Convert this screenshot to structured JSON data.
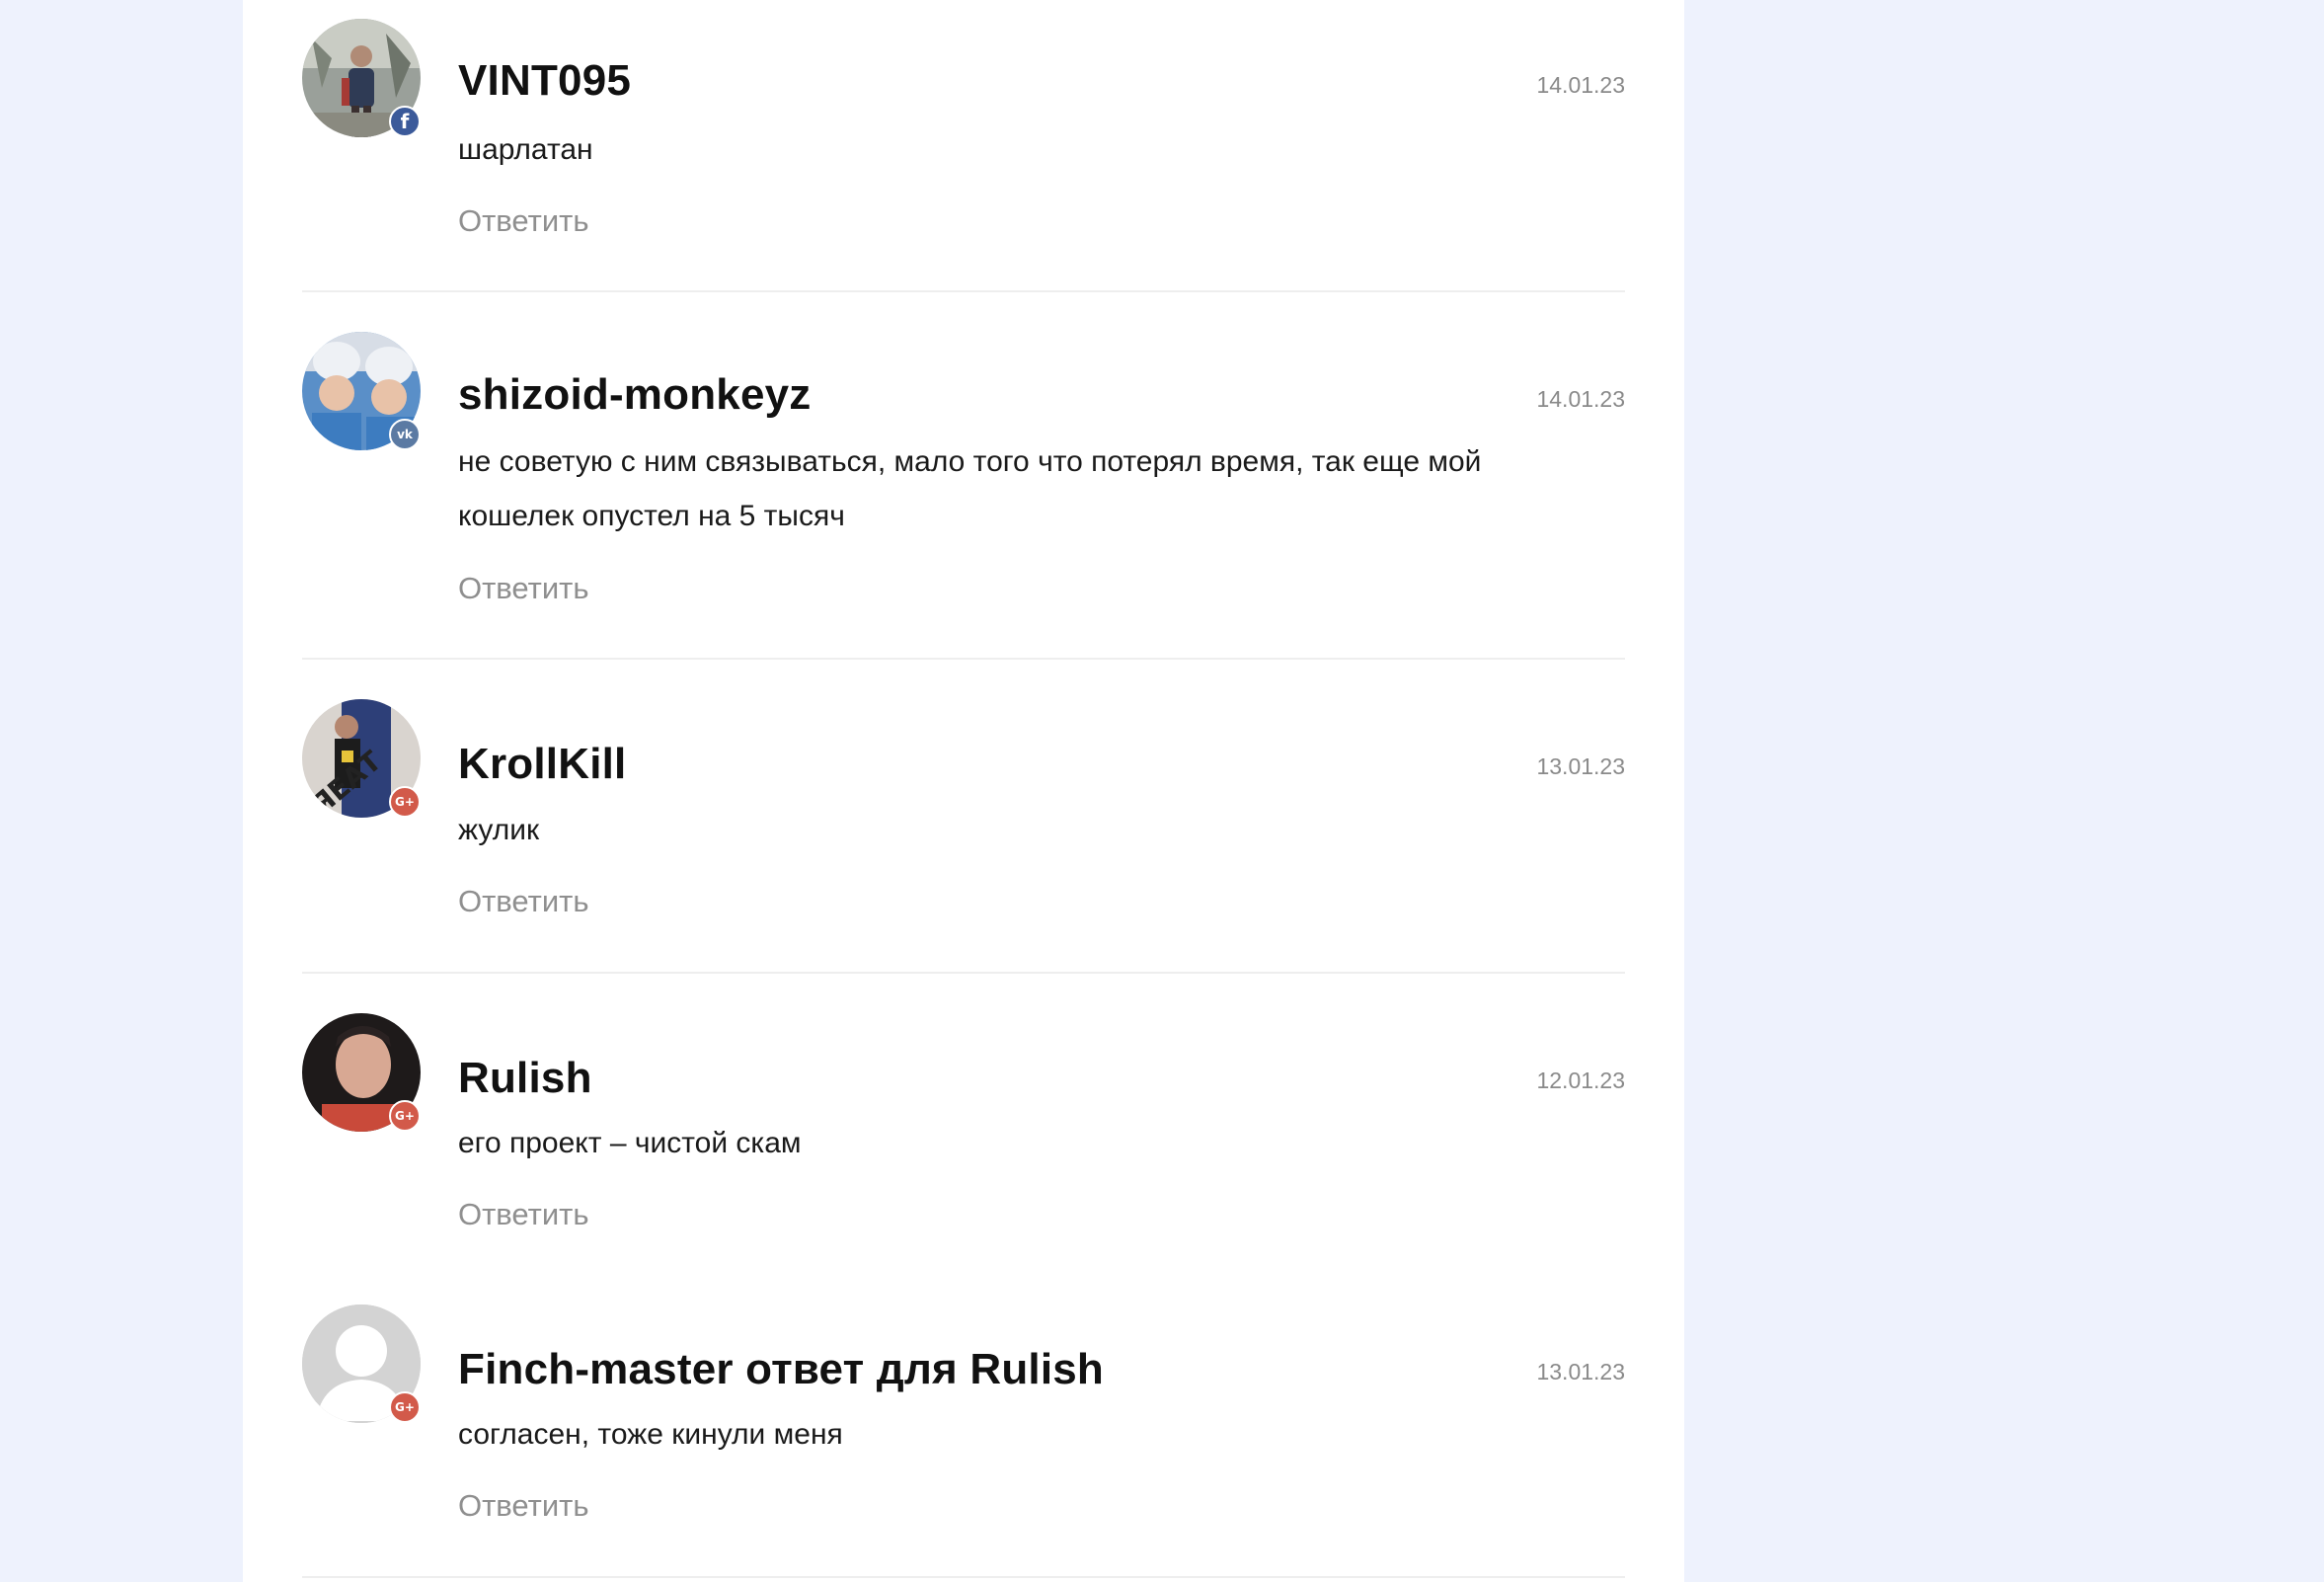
{
  "comments": [
    {
      "author": "VINT095",
      "date": "14.01.23",
      "text": "шарлатан",
      "reply_label": "Ответить",
      "network": "facebook-icon",
      "network_glyph": "f"
    },
    {
      "author": "shizoid-monkeyz",
      "date": "14.01.23",
      "text": "не советую с ним связываться, мало того что потерял время, так еще мой кошелек опустел на 5 тысяч",
      "reply_label": "Ответить",
      "network": "vk-icon",
      "network_glyph": "vk"
    },
    {
      "author": "KrollKill",
      "date": "13.01.23",
      "text": "жулик",
      "reply_label": "Ответить",
      "network": "google-plus-icon",
      "network_glyph": "G+"
    },
    {
      "author": "Rulish",
      "date": "12.01.23",
      "text": "его проект – чистой скам",
      "reply_label": "Ответить",
      "network": "google-plus-icon",
      "network_glyph": "G+"
    },
    {
      "author": "Finch-master ответ для Rulish",
      "date": "13.01.23",
      "text": "согласен, тоже кинули меня",
      "reply_label": "Ответить",
      "network": "google-plus-icon",
      "network_glyph": "G+"
    }
  ],
  "colors": {
    "page_background": "#eef2fd",
    "panel_background": "#ffffff",
    "date_text": "#8a8a8a",
    "reply_text": "#8f8f8f",
    "facebook": "#3b5a9a",
    "vk": "#5b7aa3",
    "google_plus": "#d25a4a"
  }
}
